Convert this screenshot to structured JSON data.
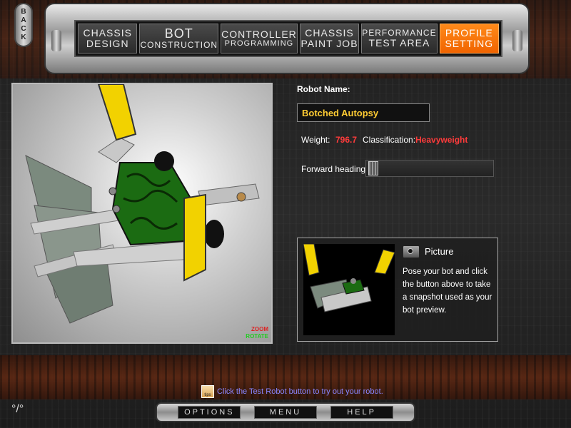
{
  "back_button": {
    "label": "BACK"
  },
  "nav": {
    "tabs": [
      {
        "line1": "CHASSIS",
        "line2": "DESIGN"
      },
      {
        "line1": "BOT",
        "line2": "CONSTRUCTION"
      },
      {
        "line1": "CONTROLLER",
        "line2": "PROGRAMMING"
      },
      {
        "line1": "CHASSIS",
        "line2": "PAINT JOB"
      },
      {
        "line1": "PERFORMANCE",
        "line2": "TEST AREA"
      },
      {
        "line1": "PROFILE",
        "line2": "SETTING"
      }
    ],
    "active_index": 5
  },
  "viewport": {
    "zoom_label": "ZOOM",
    "rotate_label": "ROTATE"
  },
  "profile": {
    "robot_name_label": "Robot Name:",
    "robot_name": "Botched Autopsy",
    "weight_label": "Weight:",
    "weight_value": "796.7",
    "classification_label": "Classification:",
    "classification_value": "Heavyweight",
    "heading_label": "Forward heading:"
  },
  "picture": {
    "title": "Picture",
    "description": "Pose your bot and click the button above to take a snapshot used as your bot preview."
  },
  "tip": {
    "icon_label": "tips",
    "text": "Click the Test Robot button to try out your robot."
  },
  "bottom": {
    "options": "OPTIONS",
    "menu": "MENU",
    "help": "HELP"
  },
  "colors": {
    "accent": "#f06400",
    "value_red": "#ff3b3b",
    "name_yellow": "#ffcc33",
    "tip_blue": "#8a86ff"
  }
}
